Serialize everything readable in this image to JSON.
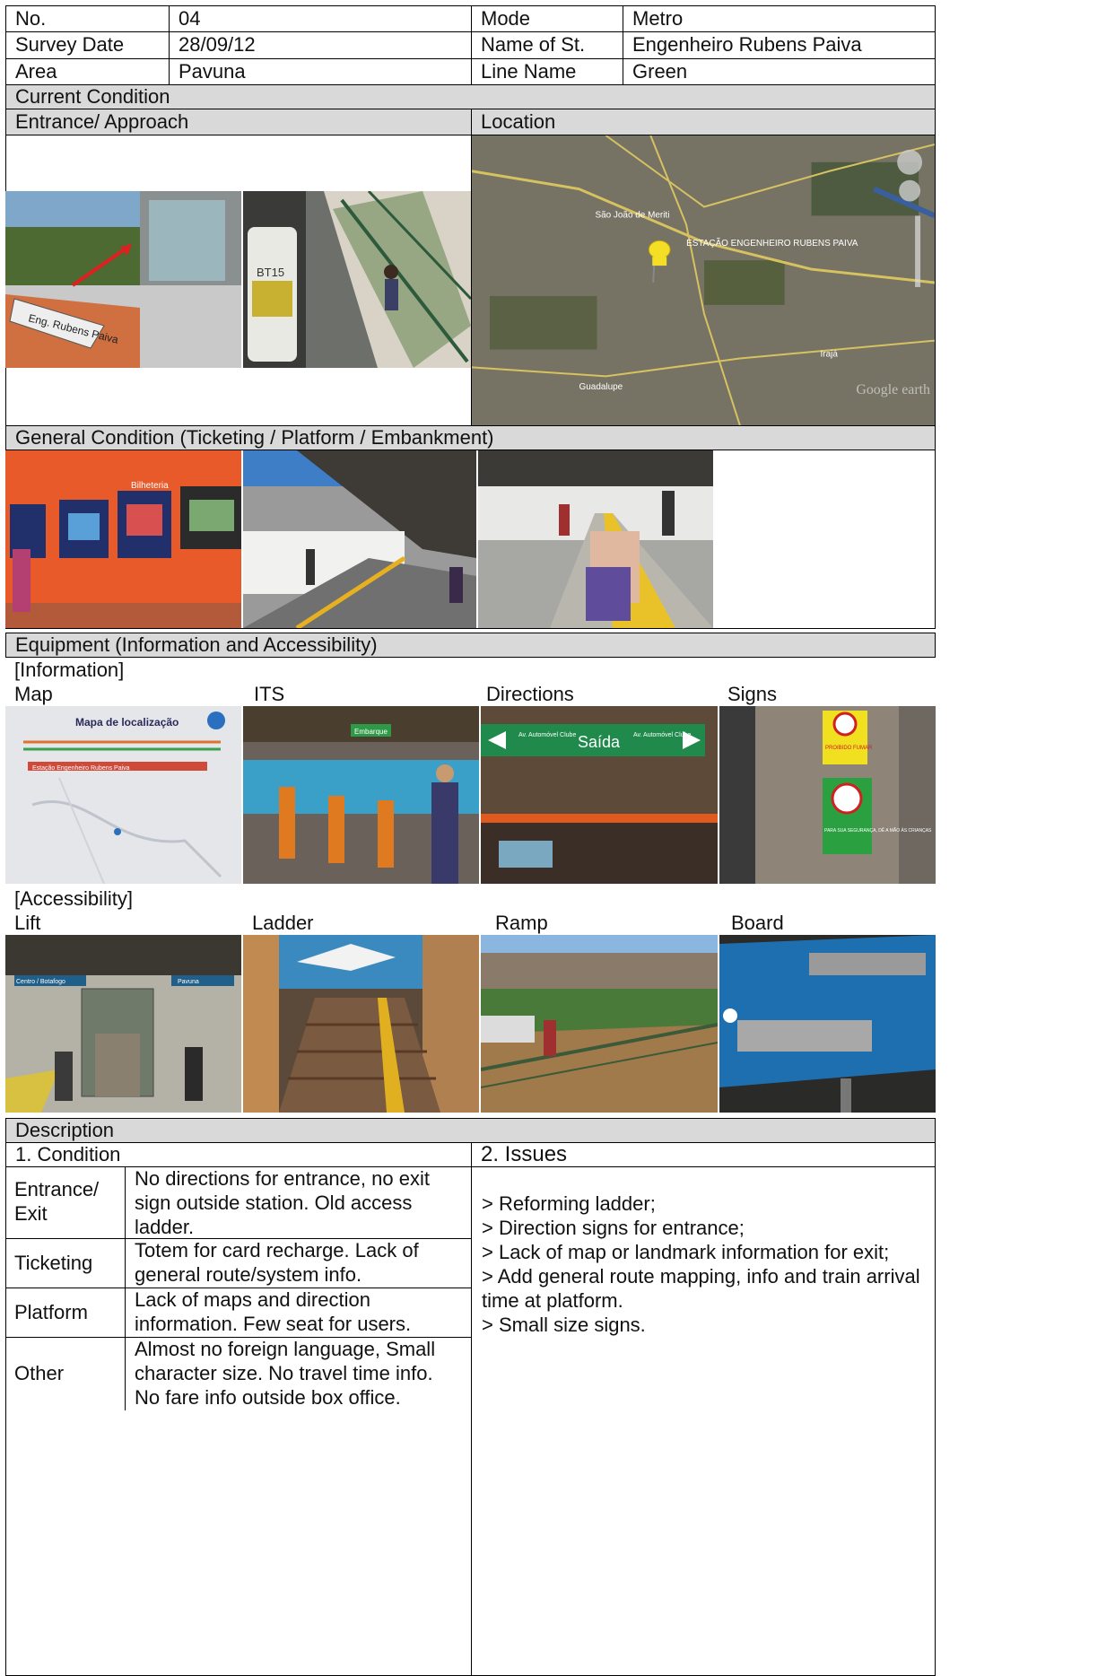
{
  "header": {
    "no_label": "No.",
    "no_value": "04",
    "mode_label": "Mode",
    "mode_value": "Metro",
    "date_label": "Survey Date",
    "date_value": "28/09/12",
    "station_label": "Name of St.",
    "station_value": "Engenheiro  Rubens  Paiva",
    "area_label": "Area",
    "area_value": "Pavuna",
    "line_label": "Line Name",
    "line_value": "Green"
  },
  "sections": {
    "current": "Current  Condition",
    "entrance": "Entrance/  Approach",
    "location": "Location",
    "general": "General  Condition  (Ticketing  / Platform  / Embankment)",
    "equipment": "Equipment  (Information   and  Accessibility)",
    "description": "Description"
  },
  "photos": {
    "sign_text": "Eng. Rubens Paiva",
    "bus_text": "BT15",
    "ticket_text": "Bilheteria"
  },
  "map": {
    "label_1": "São João de Meriti",
    "label_2": "ESTAÇÃO ENGENHEIRO RUBENS PAIVA",
    "label_3": "Guadalupe",
    "label_4": "Irajá",
    "watermark": "Google earth"
  },
  "information": {
    "heading": "[Information]",
    "items": [
      "Map",
      "ITS",
      "Directions",
      "Signs"
    ],
    "map_photo_text": "Mapa de localização",
    "map_station_text": "Estação Engenheiro Rubens Paiva",
    "its_photo_text": "Embarque",
    "dir_photo_text": "Saída",
    "dir_left": "Av. Automóvel Clube",
    "dir_right": "Av. Automóvel Clube",
    "signs_photo_text_1": "PROIBIDO FUMAR",
    "signs_photo_text_2": "PARA SUA SEGURANÇA, DÊ A MÃO ÀS CRIANÇAS"
  },
  "accessibility": {
    "heading": "[Accessibility]",
    "items": [
      "Lift",
      "Ladder",
      "Ramp",
      "Board"
    ],
    "lift_text_1": "Centro / Botafogo",
    "lift_text_2": "Pavuna"
  },
  "condition": {
    "heading": "1.   Condition",
    "rows": [
      {
        "label": "Entrance/\nExit",
        "text": "No directions for entrance, no exit sign outside station. Old access ladder."
      },
      {
        "label": "Ticketing",
        "text": "Totem for card recharge.  Lack of general route/system info."
      },
      {
        "label": "Platform",
        "text": "Lack of maps and direction information.  Few seat for users."
      },
      {
        "label": "Other",
        "text": "Almost no foreign language, Small character size. No travel time info. No fare info outside box office."
      }
    ]
  },
  "issues": {
    "heading": "2.   Issues",
    "lines": [
      "> Reforming  ladder;",
      "> Direction signs for entrance;",
      "> Lack of map or landmark  information  for exit;",
      "> Add general route mapping, info and train arrival time at platform.",
      "> Small size signs."
    ]
  }
}
